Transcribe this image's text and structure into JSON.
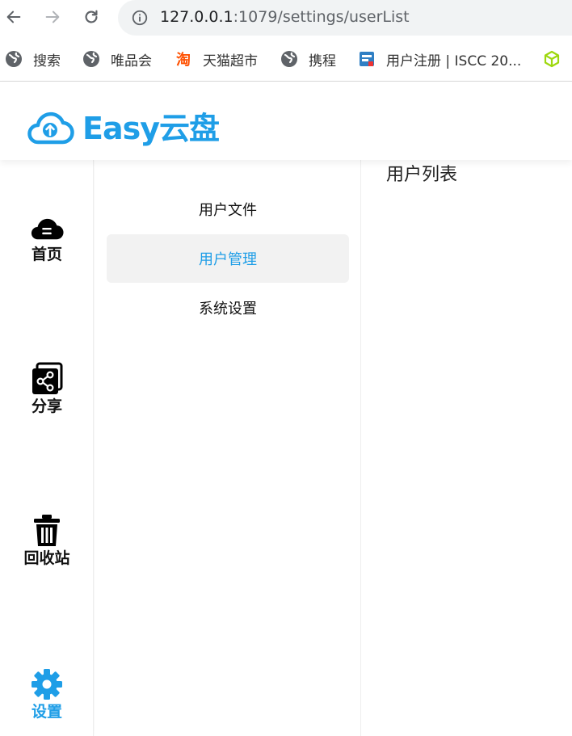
{
  "browser": {
    "url_host": "127.0.0.1",
    "url_path": ":1079/settings/userList",
    "bookmarks": [
      {
        "label": "搜索",
        "icon": "globe-icon"
      },
      {
        "label": "唯品会",
        "icon": "globe-icon"
      },
      {
        "label": "天猫超市",
        "icon": "taobao-icon"
      },
      {
        "label": "携程",
        "icon": "globe-icon"
      },
      {
        "label": "用户注册 | ISCC 20...",
        "icon": "iscc-icon"
      },
      {
        "label": "",
        "icon": "cube-icon"
      }
    ]
  },
  "app": {
    "logo_text": "Easy云盘",
    "brand_color": "#1f9ee7"
  },
  "sidebar": {
    "items": [
      {
        "label": "首页",
        "icon": "cloud-home-icon",
        "active": false
      },
      {
        "label": "分享",
        "icon": "share-icon",
        "active": false
      },
      {
        "label": "回收站",
        "icon": "trash-icon",
        "active": false
      },
      {
        "label": "设置",
        "icon": "gear-icon",
        "active": true
      }
    ]
  },
  "submenu": {
    "items": [
      {
        "label": "用户文件",
        "active": false
      },
      {
        "label": "用户管理",
        "active": true
      },
      {
        "label": "系统设置",
        "active": false
      }
    ]
  },
  "main": {
    "title": "用户列表"
  }
}
